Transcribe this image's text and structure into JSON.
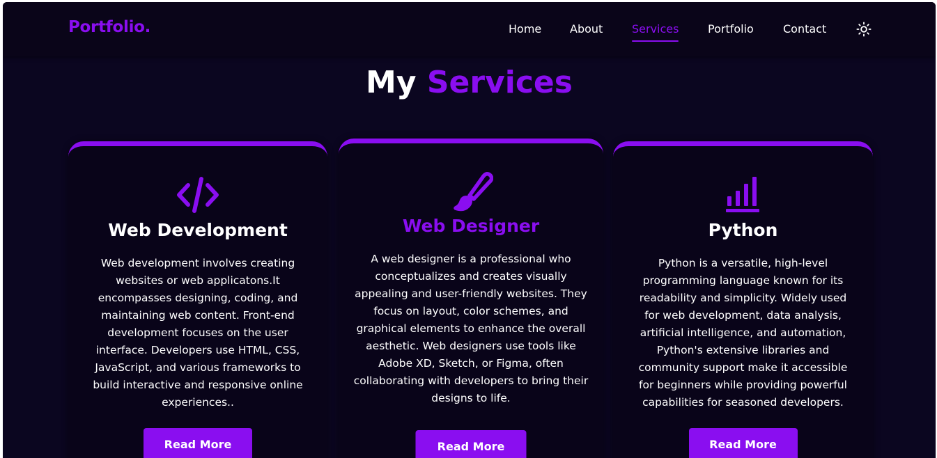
{
  "header": {
    "logo": "Portfolio.",
    "nav": [
      {
        "label": "Home"
      },
      {
        "label": "About"
      },
      {
        "label": "Services",
        "active": true
      },
      {
        "label": "Portfolio"
      },
      {
        "label": "Contact"
      }
    ],
    "theme_toggle_icon": "sun-icon"
  },
  "section": {
    "title_part1": "My",
    "title_part2": "Services"
  },
  "cards": [
    {
      "icon": "code-icon",
      "title": "Web Development",
      "description": "Web development involves creating websites or web applicatons.It encompasses designing, coding, and maintaining web content. Front-end development focuses on the user interface. Developers use HTML, CSS, JavaScript, and various frameworks to build interactive and responsive online experiences..",
      "button": "Read More"
    },
    {
      "icon": "paintbrush-icon",
      "title": "Web Designer",
      "description": "A web designer is a professional who conceptualizes and creates visually appealing and user-friendly websites. They focus on layout, color schemes, and graphical elements to enhance the overall aesthetic. Web designers use tools like Adobe XD, Sketch, or Figma, often collaborating with developers to bring their designs to life.",
      "button": "Read More"
    },
    {
      "icon": "bar-chart-icon",
      "title": "Python",
      "description": "Python is a versatile, high-level programming language known for its readability and simplicity. Widely used for web development, data analysis, artificial intelligence, and automation, Python's extensive libraries and community support make it accessible for beginners while providing powerful capabilities for seasoned developers.",
      "button": "Read More"
    }
  ],
  "colors": {
    "accent": "#8a0ef0",
    "background": "#0b0620",
    "card_background": "#090419",
    "text": "#ffffff"
  }
}
